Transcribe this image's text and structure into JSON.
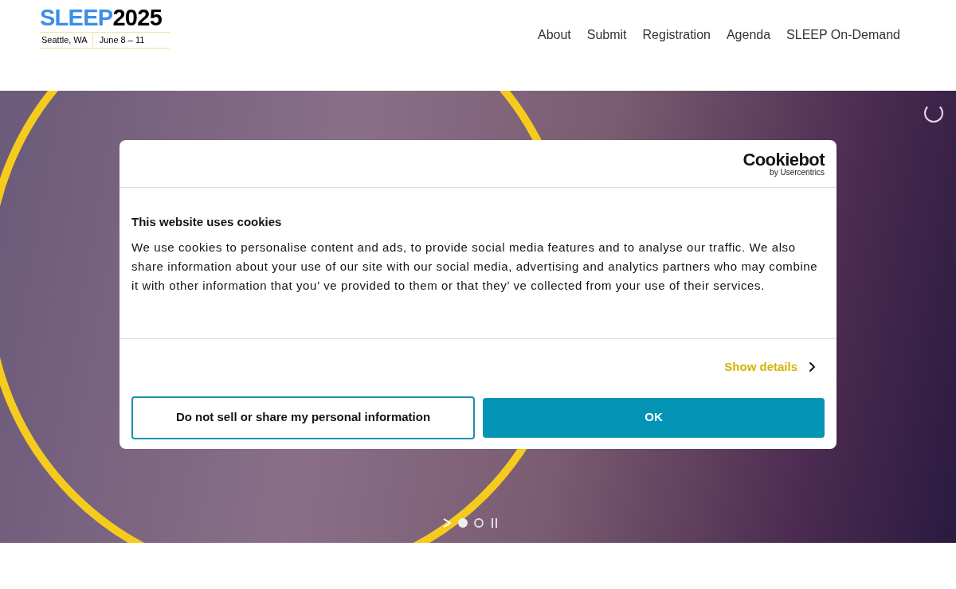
{
  "header": {
    "logo": {
      "word": "SLEEP",
      "year": "2025",
      "place": "Seattle, WA",
      "dates": "June 8 – 11"
    },
    "nav": [
      "About",
      "Submit",
      "Registration",
      "Agenda",
      "SLEEP On-Demand"
    ]
  },
  "slider": {
    "dots": [
      {
        "selected": true
      },
      {
        "selected": false
      }
    ]
  },
  "cookie_dialog": {
    "brand": "Cookiebot",
    "brand_sub": "by Usercentrics",
    "title": "This website uses cookies",
    "body": "We use cookies to personalise content and ads, to provide social media features and to analyse our traffic. We also share information about your use of our site with our social media, advertising and analytics partners who may combine it with other information that you’ ve provided to them or that they’ ve collected from your use of their services.",
    "details_link": "Show details",
    "buttons": [
      {
        "label": "Do not sell or share my personal information",
        "kind": "outline"
      },
      {
        "label": "OK",
        "kind": "primary"
      }
    ]
  }
}
